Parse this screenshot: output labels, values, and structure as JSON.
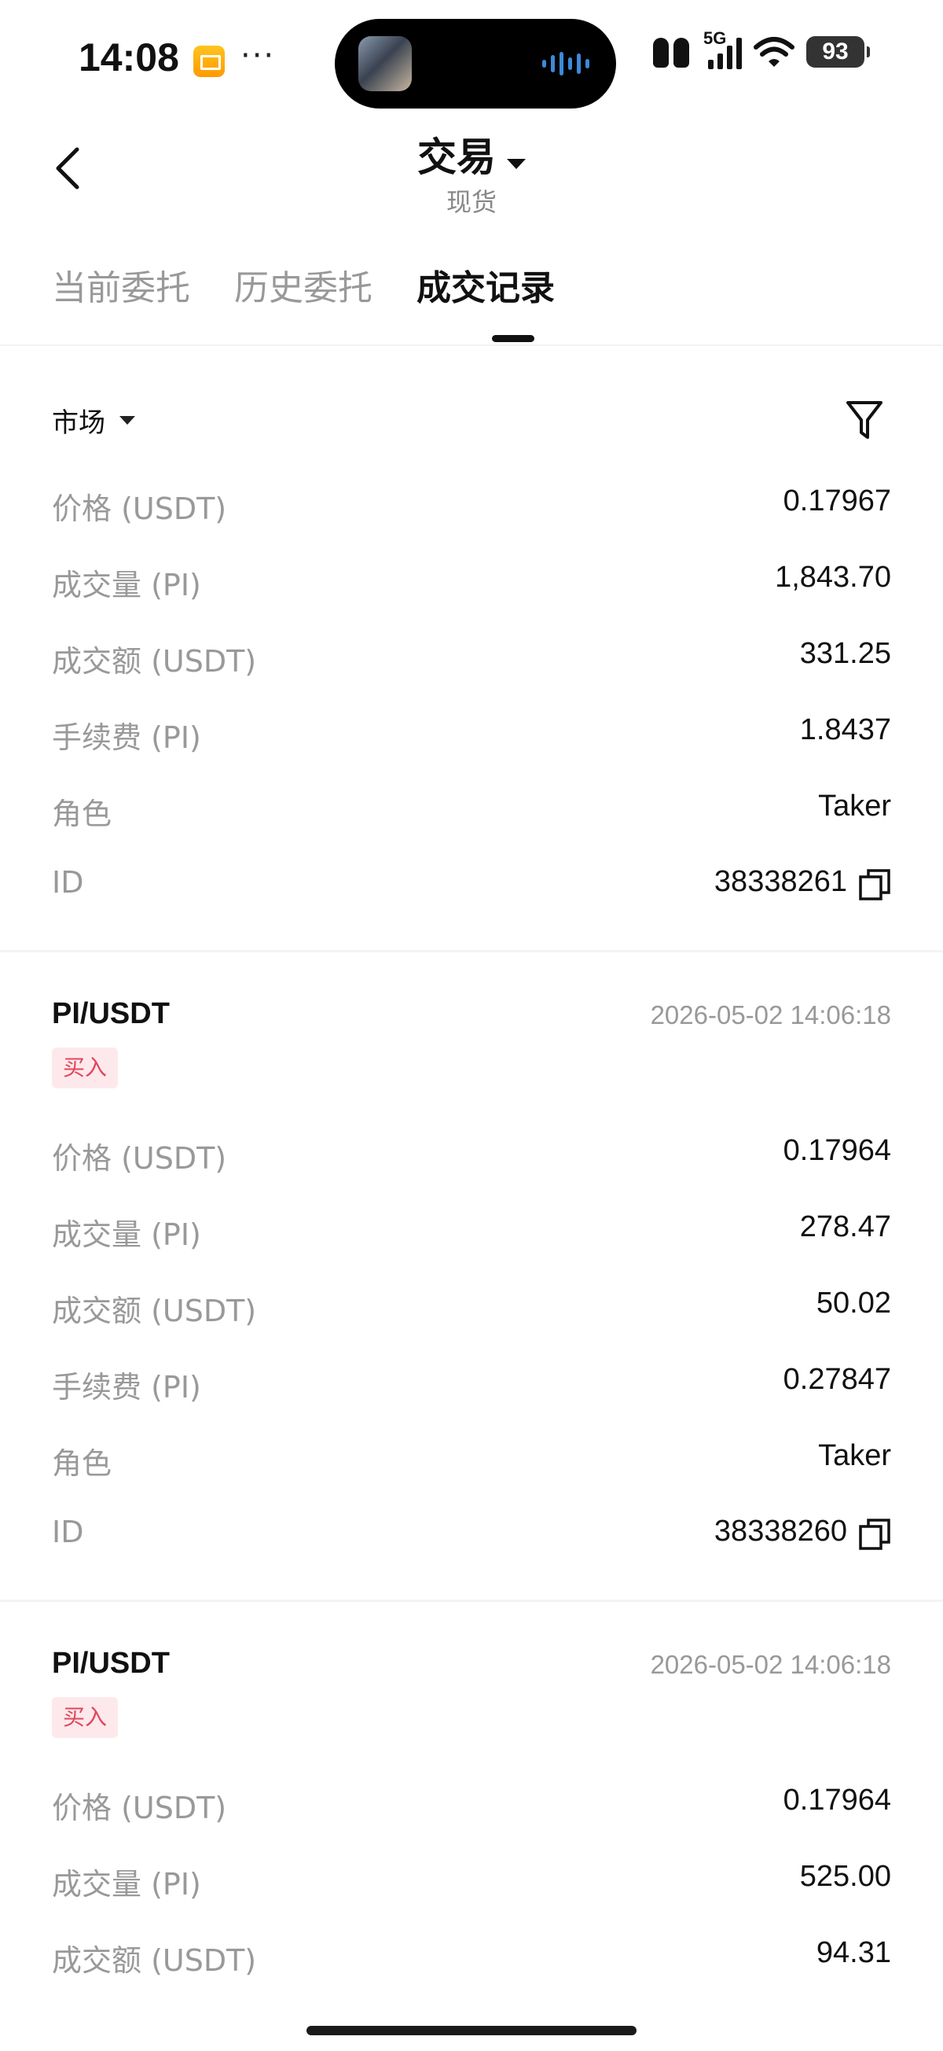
{
  "status_bar": {
    "time": "14:08",
    "more": "···",
    "network": "5G",
    "battery": "93"
  },
  "header": {
    "title": "交易",
    "subtitle": "现货"
  },
  "tabs": [
    {
      "label": "当前委托"
    },
    {
      "label": "历史委托"
    },
    {
      "label": "成交记录"
    }
  ],
  "filter": {
    "market_label": "市场"
  },
  "trades": [
    {
      "rows": [
        {
          "label": "价格 (USDT)",
          "value": "0.17967"
        },
        {
          "label": "成交量 (PI)",
          "value": "1,843.70"
        },
        {
          "label": "成交额 (USDT)",
          "value": "331.25"
        },
        {
          "label": "手续费 (PI)",
          "value": "1.8437"
        },
        {
          "label": "角色",
          "value": "Taker"
        },
        {
          "label": "ID",
          "value": "38338261"
        }
      ]
    },
    {
      "pair": "PI/USDT",
      "datetime": "2026-05-02 14:06:18",
      "side": "买入",
      "rows": [
        {
          "label": "价格 (USDT)",
          "value": "0.17964"
        },
        {
          "label": "成交量 (PI)",
          "value": "278.47"
        },
        {
          "label": "成交额 (USDT)",
          "value": "50.02"
        },
        {
          "label": "手续费 (PI)",
          "value": "0.27847"
        },
        {
          "label": "角色",
          "value": "Taker"
        },
        {
          "label": "ID",
          "value": "38338260"
        }
      ]
    },
    {
      "pair": "PI/USDT",
      "datetime": "2026-05-02 14:06:18",
      "side": "买入",
      "rows": [
        {
          "label": "价格 (USDT)",
          "value": "0.17964"
        },
        {
          "label": "成交量 (PI)",
          "value": "525.00"
        },
        {
          "label": "成交额 (USDT)",
          "value": "94.31"
        }
      ]
    }
  ],
  "colors": {
    "buy_badge_bg": "#fde9ec",
    "buy_badge_text": "#e2465d",
    "label_gray": "#999999",
    "text_primary": "#111111"
  },
  "icons": [
    "mail-icon",
    "airpods-icon",
    "cellular-signal-icon",
    "wifi-icon",
    "battery-icon",
    "back-chevron-icon",
    "dropdown-caret-icon",
    "filter-funnel-icon",
    "copy-icon"
  ]
}
